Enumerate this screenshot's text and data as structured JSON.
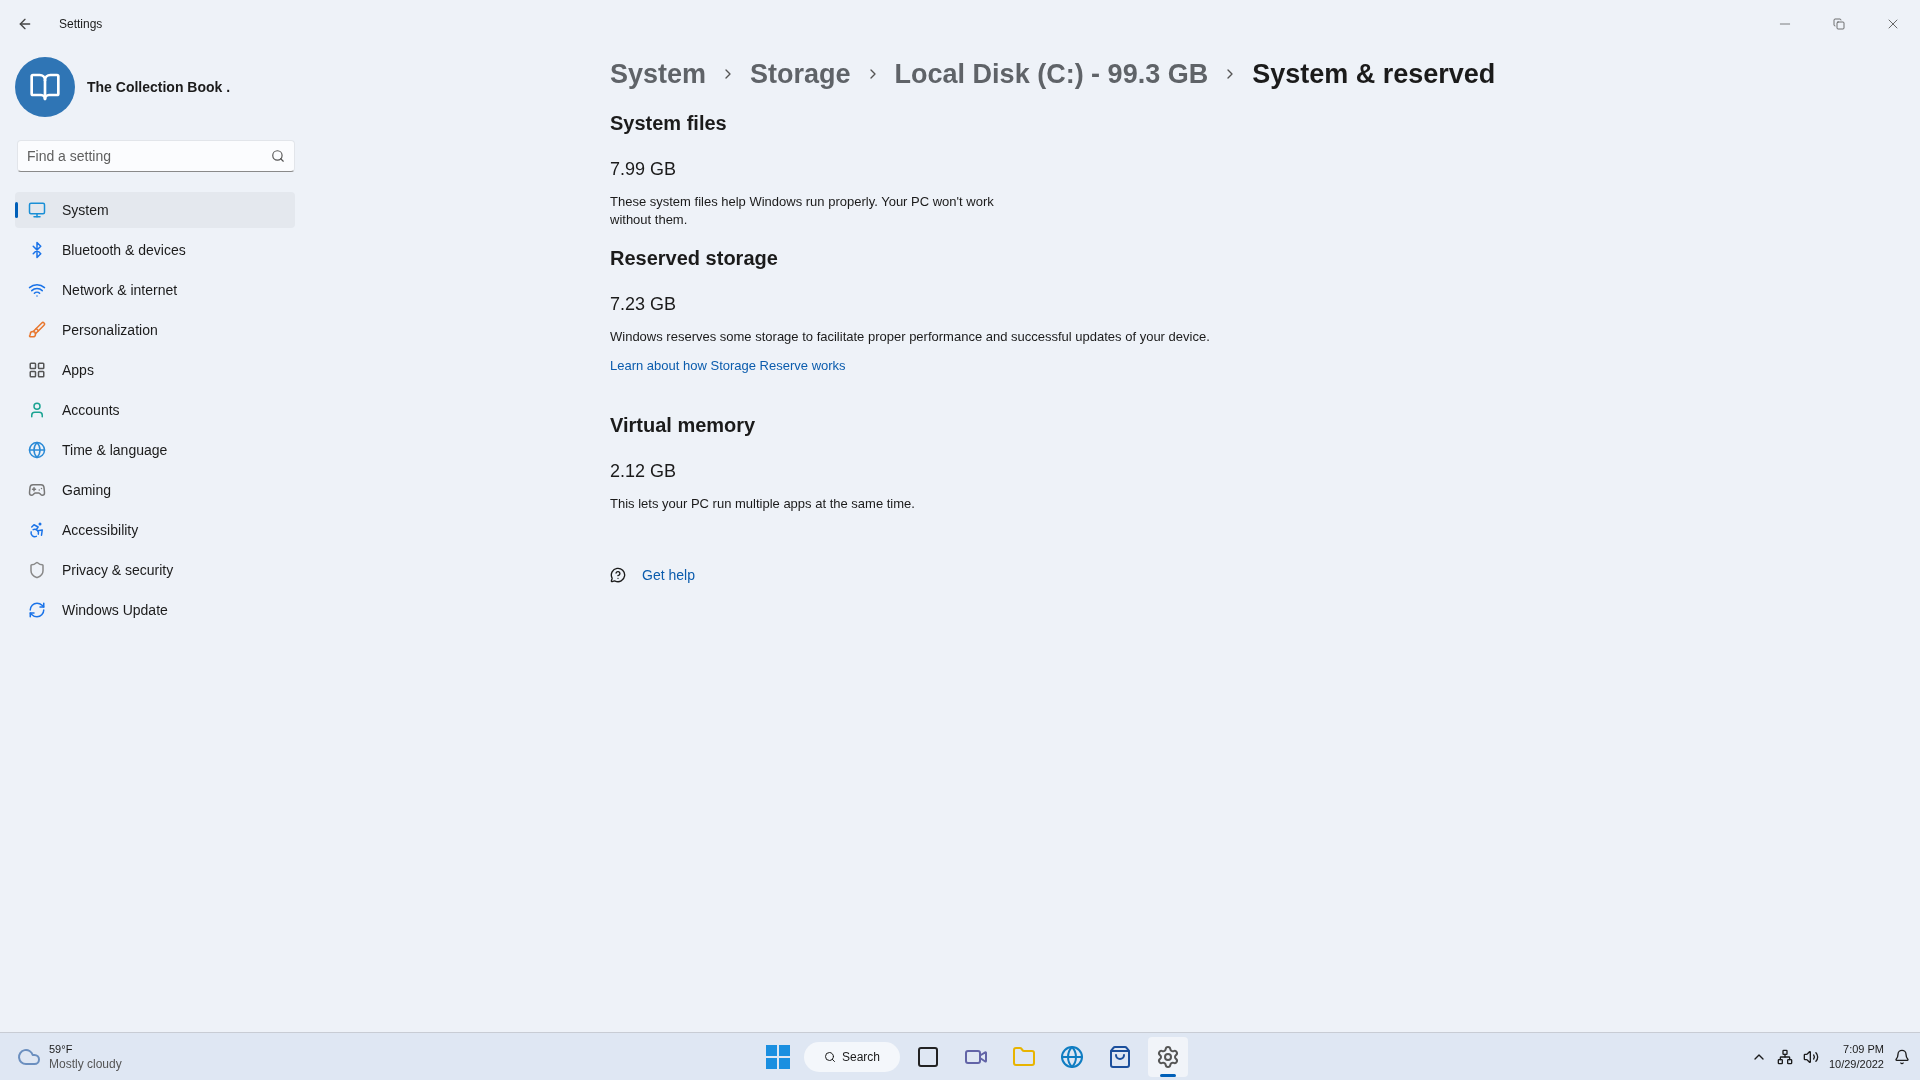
{
  "window": {
    "title": "Settings"
  },
  "profile": {
    "name": "The Collection Book ."
  },
  "search": {
    "placeholder": "Find a setting"
  },
  "sidebar": {
    "items": [
      {
        "label": "System",
        "selected": true
      },
      {
        "label": "Bluetooth & devices",
        "selected": false
      },
      {
        "label": "Network & internet",
        "selected": false
      },
      {
        "label": "Personalization",
        "selected": false
      },
      {
        "label": "Apps",
        "selected": false
      },
      {
        "label": "Accounts",
        "selected": false
      },
      {
        "label": "Time & language",
        "selected": false
      },
      {
        "label": "Gaming",
        "selected": false
      },
      {
        "label": "Accessibility",
        "selected": false
      },
      {
        "label": "Privacy & security",
        "selected": false
      },
      {
        "label": "Windows Update",
        "selected": false
      }
    ]
  },
  "breadcrumb": [
    "System",
    "Storage",
    "Local Disk (C:) - 99.3 GB",
    "System & reserved"
  ],
  "sections": [
    {
      "heading": "System files",
      "size": "7.99 GB",
      "description": "These system files help Windows run properly. Your PC won't work without them."
    },
    {
      "heading": "Reserved storage",
      "size": "7.23 GB",
      "description": "Windows reserves some storage to facilitate proper performance and successful updates of your device.",
      "link": "Learn about how Storage Reserve works"
    },
    {
      "heading": "Virtual memory",
      "size": "2.12 GB",
      "description": "This lets your PC run multiple apps at the same time."
    }
  ],
  "help": {
    "label": "Get help"
  },
  "taskbar": {
    "weather": {
      "temperature": "59°F",
      "condition": "Mostly cloudy"
    },
    "search_label": "Search",
    "apps": [
      {
        "selected": false
      },
      {
        "selected": false
      },
      {
        "selected": false
      },
      {
        "selected": false
      },
      {
        "selected": false
      },
      {
        "selected": true
      }
    ],
    "time": "7:09 PM",
    "date": "10/29/2022"
  }
}
